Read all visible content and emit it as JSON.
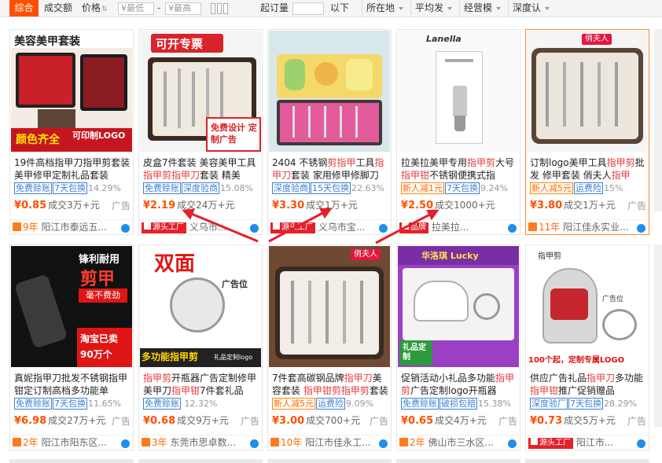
{
  "filterbar": {
    "tab_active": "综合",
    "tab_volume": "成交额",
    "sort_price": "价格",
    "min_placeholder": "¥最低",
    "max_placeholder": "¥最高",
    "moq_label": "起订量",
    "moq_suffix": "以下",
    "location": "所在地",
    "avg_price": "平均发",
    "business_model": "经营模",
    "deep_cert": "深度认"
  },
  "products": [
    {
      "image_caption_top": "美容美甲套装",
      "image_caption_mid": "颜色齐全",
      "image_caption_bot": "可印制LOGO",
      "title": [
        "19件高档指甲刀指甲剪套装 美甲修甲定制礼品套装",
        ""
      ],
      "tags": [
        "免费赊账",
        "7天包换"
      ],
      "rate": "14.29%",
      "price": "¥0.85",
      "sales": "成交3万+元",
      "ad": "广告",
      "years": "9年",
      "store": "阳江市泰远五..."
    },
    {
      "image_caption_top": "可开专票",
      "image_caption_bot": "免费设计 定制广告",
      "title_pre": "皮盒7件套装 美容美甲工具 ",
      "title_kw": "指甲剪指甲刀",
      "title_post": "套装 精美",
      "tags": [
        "免费赊账",
        "深度验商"
      ],
      "rate": "15.08%",
      "price": "¥2.19",
      "sales": "成交24万+元",
      "ad": "",
      "badge": "源头工厂",
      "store": "义乌市...",
      "years": ""
    },
    {
      "title_pre": "2404 不锈钢",
      "title_kw": "剪指甲",
      "title_mid": "工具",
      "title_kw2": "指甲刀",
      "title_post": "套装 家用修甲修脚刀",
      "tags": [
        "深度验商",
        "15天包换"
      ],
      "rate": "22.63%",
      "price": "¥3.30",
      "sales": "成交1万+元",
      "badge": "源头工厂",
      "store": "义乌市宝..."
    },
    {
      "image_brand": "Lanella",
      "title_pre": "拉美拉美甲专用",
      "title_kw": "指甲剪",
      "title_mid": "大号",
      "title_kw2": "指甲钳",
      "title_post": "不锈钢便携式指",
      "tags": [
        "新人减1元",
        "7天包换"
      ],
      "rate": "9.24%",
      "price": "¥2.50",
      "sales": "成交1000+元",
      "badge": "品牌",
      "store": "拉美拉..."
    },
    {
      "image_brand": "俏夫人",
      "title_pre": "订制logo美甲工具",
      "title_kw": "指甲剪",
      "title_mid": "批发 修甲套装 俏夫人",
      "title_kw2": "指甲",
      "title_post": "",
      "tags": [
        "新人减5元",
        "运费险"
      ],
      "rate": "15%",
      "price": "¥3.80",
      "sales": "成交1万+元",
      "ad": "广告",
      "years": "11年",
      "store": "阳江佳永实业..."
    },
    {
      "image_caption_top": "锋利耐用",
      "image_caption_mid": "剪甲",
      "image_caption_sub": "毫不费劲",
      "image_caption_bot": "淘宝已卖90万个",
      "title": [
        "真妮指甲刀批发不锈钢指甲钳定订制高档多功能单",
        ""
      ],
      "tags": [
        "免费赊账",
        "7天包换"
      ],
      "rate": "11.65%",
      "price": "¥6.98",
      "sales": "成交27万+元",
      "ad": "广告",
      "years": "2年",
      "store": "阳江市阳东区..."
    },
    {
      "image_caption_top": "双面",
      "image_caption_mid": "广告位",
      "image_caption_bot": "多功能指甲剪",
      "image_caption_sub": "礼品定制logo",
      "title_kw": "指甲剪",
      "title_pre": "",
      "title_mid": "开瓶器广告定制修甲美甲刀",
      "title_kw2": "指甲钳",
      "title_post": "7件套礼品",
      "tags": [
        "免费赊账"
      ],
      "rate": "12.32%",
      "price": "¥0.68",
      "sales": "成交9万+元",
      "ad": "广告",
      "years": "3年",
      "store": "东莞市思卓数..."
    },
    {
      "image_brand": "俏夫人",
      "title_pre": "7件套高碳钢品牌",
      "title_kw": "指甲刀",
      "title_mid": "美容套装 ",
      "title_kw2": "指甲钳剪指甲剪",
      "title_post": "套装",
      "tags": [
        "新人减5元",
        "运费险"
      ],
      "rate": "9.09%",
      "price": "¥3.00",
      "sales": "成交700+元",
      "ad": "广告",
      "years": "10年",
      "store": "阳江市佳永工..."
    },
    {
      "image_caption_top": "华洛琪 Lucky",
      "image_caption_bot": "礼品定制",
      "title_pre": "促销活动小礼品多功能",
      "title_kw": "指甲剪",
      "title_mid": "广告定制logo开瓶器",
      "title_kw2": "",
      "title_post": "",
      "tags": [
        "免费赊账",
        "破损包赔"
      ],
      "rate": "15.38%",
      "price": "¥0.65",
      "sales": "成交4万+元",
      "ad": "广告",
      "years": "2年",
      "store": "佛山市三水区..."
    },
    {
      "image_caption_top": "指甲剪",
      "image_caption_mid": "广告位",
      "image_caption_bot": "100个起，定制专属LOGO",
      "title_pre": "供应广告礼品",
      "title_kw": "指甲刀",
      "title_mid": "多功能",
      "title_kw2": "指甲钳",
      "title_post": "推广促销赠品",
      "tags": [
        "深度验厂",
        "7天包换"
      ],
      "rate": "28.29%",
      "price": "¥0.73",
      "sales": "成交5万+元",
      "ad": "广告",
      "badge": "源头工厂",
      "store": "阳江市..."
    }
  ],
  "colors": {
    "accent": "#ff5000",
    "keyword": "#e4393c",
    "tag": "#3d7fd1",
    "arrow": "#e4202a"
  }
}
